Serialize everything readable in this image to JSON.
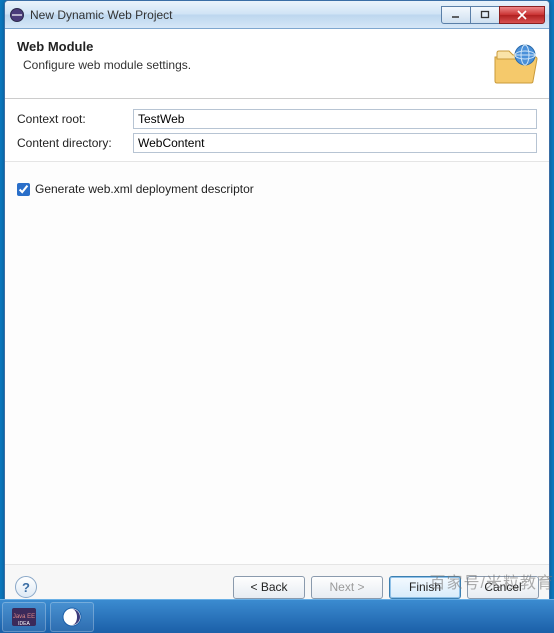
{
  "window": {
    "title": "New Dynamic Web Project"
  },
  "header": {
    "title": "Web Module",
    "subtitle": "Configure web module settings."
  },
  "form": {
    "context_root_label": "Context root:",
    "context_root_value": "TestWeb",
    "content_dir_label": "Content directory:",
    "content_dir_value": "WebContent"
  },
  "options": {
    "generate_webxml_label": "Generate web.xml deployment descriptor",
    "generate_webxml_checked": true
  },
  "buttons": {
    "back": "< Back",
    "next": "Next >",
    "finish": "Finish",
    "cancel": "Cancel"
  },
  "watermark": "百家号/米粒教育"
}
